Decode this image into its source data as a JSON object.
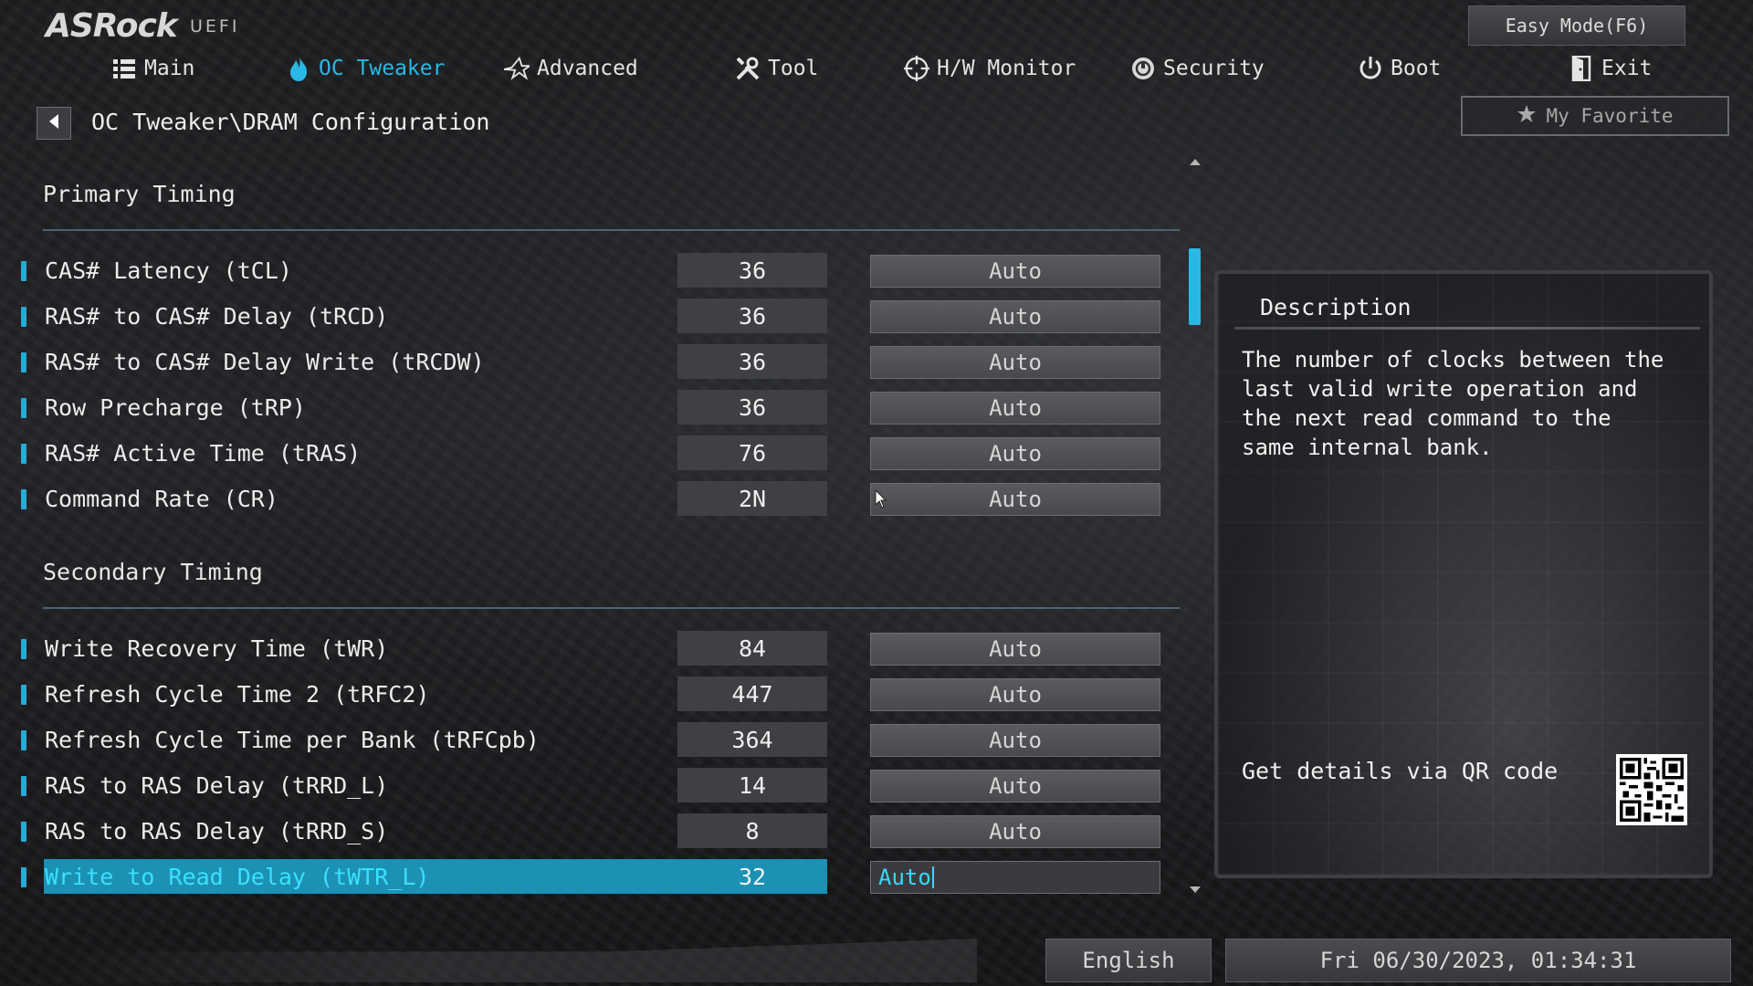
{
  "brand": {
    "logo": "ASRock",
    "sub": "UEFI"
  },
  "header": {
    "easy_mode": "Easy Mode(F6)",
    "favorite": "My Favorite"
  },
  "nav": [
    {
      "label": "Main",
      "icon": "list-icon",
      "active": false
    },
    {
      "label": "OC Tweaker",
      "icon": "flame-icon",
      "active": true
    },
    {
      "label": "Advanced",
      "icon": "star-icon",
      "active": false
    },
    {
      "label": "Tool",
      "icon": "tools-icon",
      "active": false
    },
    {
      "label": "H/W Monitor",
      "icon": "crosshair-icon",
      "active": false
    },
    {
      "label": "Security",
      "icon": "shield-icon",
      "active": false
    },
    {
      "label": "Boot",
      "icon": "power-icon",
      "active": false
    },
    {
      "label": "Exit",
      "icon": "exit-door-icon",
      "active": false
    }
  ],
  "breadcrumb": "OC Tweaker\\DRAM Configuration",
  "sections": {
    "primary": {
      "title": "Primary Timing",
      "rows": [
        {
          "label": "CAS# Latency (tCL)",
          "value": "36",
          "setting": "Auto"
        },
        {
          "label": "RAS# to CAS# Delay (tRCD)",
          "value": "36",
          "setting": "Auto"
        },
        {
          "label": "RAS# to CAS# Delay Write (tRCDW)",
          "value": "36",
          "setting": "Auto"
        },
        {
          "label": "Row Precharge (tRP)",
          "value": "36",
          "setting": "Auto"
        },
        {
          "label": "RAS# Active Time (tRAS)",
          "value": "76",
          "setting": "Auto"
        },
        {
          "label": "Command Rate (CR)",
          "value": "2N",
          "setting": "Auto"
        }
      ]
    },
    "secondary": {
      "title": "Secondary Timing",
      "rows": [
        {
          "label": "Write Recovery Time (tWR)",
          "value": "84",
          "setting": "Auto"
        },
        {
          "label": "Refresh Cycle Time 2 (tRFC2)",
          "value": "447",
          "setting": "Auto"
        },
        {
          "label": "Refresh Cycle Time per Bank (tRFCpb)",
          "value": "364",
          "setting": "Auto"
        },
        {
          "label": "RAS to RAS Delay (tRRD_L)",
          "value": "14",
          "setting": "Auto"
        },
        {
          "label": "RAS to RAS Delay (tRRD_S)",
          "value": "8",
          "setting": "Auto"
        },
        {
          "label": "Write to Read Delay (tWTR_L)",
          "value": "32",
          "setting": "Auto",
          "selected": true
        }
      ]
    }
  },
  "description": {
    "title": "Description",
    "text": "The number of clocks between the last valid write operation and the next read command to the same internal bank.",
    "qr_label": "Get details via QR code"
  },
  "footer": {
    "language": "English",
    "datetime": "Fri 06/30/2023, 01:34:31"
  },
  "colors": {
    "accent": "#29b8e6",
    "selected_row": "#1b91b4",
    "selected_text": "#3be0ff"
  }
}
